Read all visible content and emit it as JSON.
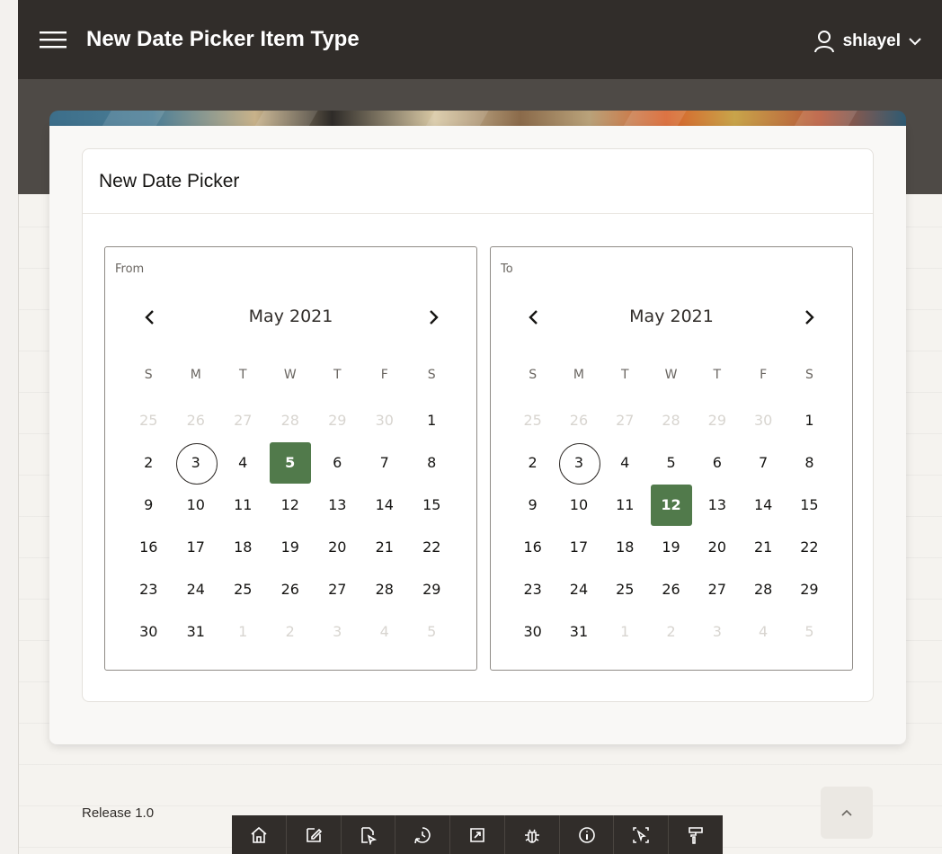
{
  "header": {
    "title": "New Date Picker Item Type",
    "username": "shlayel"
  },
  "region": {
    "title": "New Date Picker"
  },
  "day_headers": [
    "S",
    "M",
    "T",
    "W",
    "T",
    "F",
    "S"
  ],
  "pickers": [
    {
      "id": "from",
      "label": "From",
      "month": "May 2021",
      "today": 3,
      "selected": 5,
      "days": [
        {
          "d": "25",
          "m": true
        },
        {
          "d": "26",
          "m": true
        },
        {
          "d": "27",
          "m": true
        },
        {
          "d": "28",
          "m": true
        },
        {
          "d": "29",
          "m": true
        },
        {
          "d": "30",
          "m": true
        },
        {
          "d": "1"
        },
        {
          "d": "2"
        },
        {
          "d": "3"
        },
        {
          "d": "4"
        },
        {
          "d": "5"
        },
        {
          "d": "6"
        },
        {
          "d": "7"
        },
        {
          "d": "8"
        },
        {
          "d": "9"
        },
        {
          "d": "10"
        },
        {
          "d": "11"
        },
        {
          "d": "12"
        },
        {
          "d": "13"
        },
        {
          "d": "14"
        },
        {
          "d": "15"
        },
        {
          "d": "16"
        },
        {
          "d": "17"
        },
        {
          "d": "18"
        },
        {
          "d": "19"
        },
        {
          "d": "20"
        },
        {
          "d": "21"
        },
        {
          "d": "22"
        },
        {
          "d": "23"
        },
        {
          "d": "24"
        },
        {
          "d": "25"
        },
        {
          "d": "26"
        },
        {
          "d": "27"
        },
        {
          "d": "28"
        },
        {
          "d": "29"
        },
        {
          "d": "30"
        },
        {
          "d": "31"
        },
        {
          "d": "1",
          "m": true
        },
        {
          "d": "2",
          "m": true
        },
        {
          "d": "3",
          "m": true
        },
        {
          "d": "4",
          "m": true
        },
        {
          "d": "5",
          "m": true
        }
      ]
    },
    {
      "id": "to",
      "label": "To",
      "month": "May 2021",
      "today": 3,
      "selected": 12,
      "days": [
        {
          "d": "25",
          "m": true
        },
        {
          "d": "26",
          "m": true
        },
        {
          "d": "27",
          "m": true
        },
        {
          "d": "28",
          "m": true
        },
        {
          "d": "29",
          "m": true
        },
        {
          "d": "30",
          "m": true
        },
        {
          "d": "1"
        },
        {
          "d": "2"
        },
        {
          "d": "3"
        },
        {
          "d": "4"
        },
        {
          "d": "5"
        },
        {
          "d": "6"
        },
        {
          "d": "7"
        },
        {
          "d": "8"
        },
        {
          "d": "9"
        },
        {
          "d": "10"
        },
        {
          "d": "11"
        },
        {
          "d": "12"
        },
        {
          "d": "13"
        },
        {
          "d": "14"
        },
        {
          "d": "15"
        },
        {
          "d": "16"
        },
        {
          "d": "17"
        },
        {
          "d": "18"
        },
        {
          "d": "19"
        },
        {
          "d": "20"
        },
        {
          "d": "21"
        },
        {
          "d": "22"
        },
        {
          "d": "23"
        },
        {
          "d": "24"
        },
        {
          "d": "25"
        },
        {
          "d": "26"
        },
        {
          "d": "27"
        },
        {
          "d": "28"
        },
        {
          "d": "29"
        },
        {
          "d": "30"
        },
        {
          "d": "31"
        },
        {
          "d": "1",
          "m": true
        },
        {
          "d": "2",
          "m": true
        },
        {
          "d": "3",
          "m": true
        },
        {
          "d": "4",
          "m": true
        },
        {
          "d": "5",
          "m": true
        }
      ]
    }
  ],
  "footer": {
    "release": "Release 1.0"
  },
  "dev_toolbar": {
    "items": [
      "home-icon",
      "edit-page-icon",
      "page-designer-icon",
      "session-icon",
      "quick-sql-icon",
      "debug-icon",
      "info-icon",
      "quick-edit-icon",
      "theme-roller-icon"
    ]
  },
  "colors": {
    "header_bg": "#312d2a",
    "selected_bg": "#517a4b",
    "muted_day": "#d8d5d0"
  }
}
